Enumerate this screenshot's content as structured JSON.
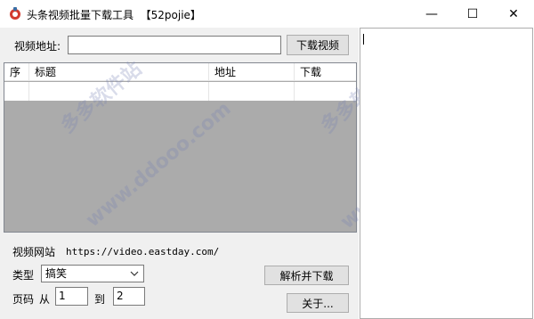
{
  "window": {
    "title": "头条视频批量下载工具  【52pojie】",
    "icon": "app-icon",
    "controls": {
      "minimize": "—",
      "maximize": "☐",
      "close": "✕"
    }
  },
  "form": {
    "url_label": "视频地址:",
    "url_value": "",
    "download_button": "下载视频"
  },
  "list": {
    "columns": [
      "序",
      "标题",
      "地址",
      "下载"
    ],
    "rows": [
      [
        "",
        "",
        "",
        ""
      ]
    ]
  },
  "site": {
    "label": "视频网站",
    "url": "https://video.eastday.com/"
  },
  "category": {
    "label": "类型",
    "selected": "搞笑"
  },
  "pages": {
    "label": "页码",
    "from_label": "从",
    "from_value": "1",
    "to_label": "到",
    "to_value": "2"
  },
  "buttons": {
    "parse_download": "解析并下载",
    "about": "关于..."
  },
  "watermarks": [
    "多多软件站",
    "www.ddooo.com",
    "多多软件站",
    "www.ddooo.com"
  ],
  "colors": {
    "client_bg": "#f0f0f0",
    "list_empty_bg": "#ababab",
    "button_bg": "#e1e1e1"
  }
}
